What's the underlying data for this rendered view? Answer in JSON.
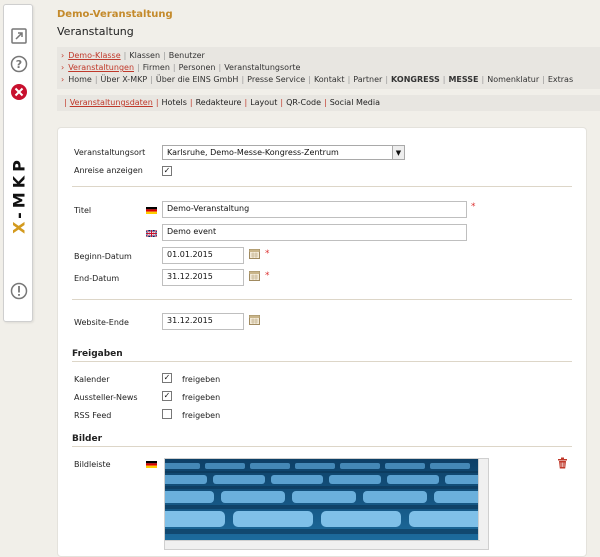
{
  "brand": {
    "text": "X-MKP"
  },
  "header": {
    "title": "Demo-Veranstaltung",
    "subtitle": "Veranstaltung"
  },
  "nav": {
    "row1": [
      "Demo-Klasse",
      "Klassen",
      "Benutzer"
    ],
    "row2": [
      "Veranstaltungen",
      "Firmen",
      "Personen",
      "Veranstaltungsorte"
    ],
    "row3": [
      "Home",
      "Über X-MKP",
      "Über die EINS GmbH",
      "Presse Service",
      "Kontakt",
      "Partner",
      "KONGRESS",
      "MESSE",
      "Nomenklatur",
      "Extras"
    ]
  },
  "tabs": [
    "Veranstaltungsdaten",
    "Hotels",
    "Redakteure",
    "Layout",
    "QR-Code",
    "Social Media"
  ],
  "form": {
    "venue_label": "Veranstaltungsort",
    "venue_value": "Karlsruhe, Demo-Messe-Kongress-Zentrum",
    "arrival_label": "Anreise anzeigen",
    "title_label": "Titel",
    "title_de": "Demo-Veranstaltung",
    "title_en": "Demo event",
    "start_label": "Beginn-Datum",
    "start_value": "01.01.2015",
    "end_label": "End-Datum",
    "end_value": "31.12.2015",
    "website_end_label": "Website-Ende",
    "website_end_value": "31.12.2015",
    "required_mark": "*"
  },
  "releases": {
    "section_title": "Freigaben",
    "items": [
      {
        "label": "Kalender",
        "action": "freigeben",
        "checked": true
      },
      {
        "label": "Aussteller-News",
        "action": "freigeben",
        "checked": true
      },
      {
        "label": "RSS Feed",
        "action": "freigeben",
        "checked": false
      }
    ]
  },
  "images": {
    "section_title": "Bilder",
    "strip_label": "Bildleiste"
  },
  "icons": {
    "sidebar": [
      "external-link-icon",
      "help-icon",
      "close-icon",
      "info-icon"
    ],
    "flag_de": "german-flag-icon",
    "flag_en": "uk-flag-icon",
    "calendar": "calendar-icon",
    "delete": "trash-icon"
  },
  "colors": {
    "accent": "#c48a2b",
    "link_active": "#c0392b",
    "close_red": "#c8102e"
  }
}
